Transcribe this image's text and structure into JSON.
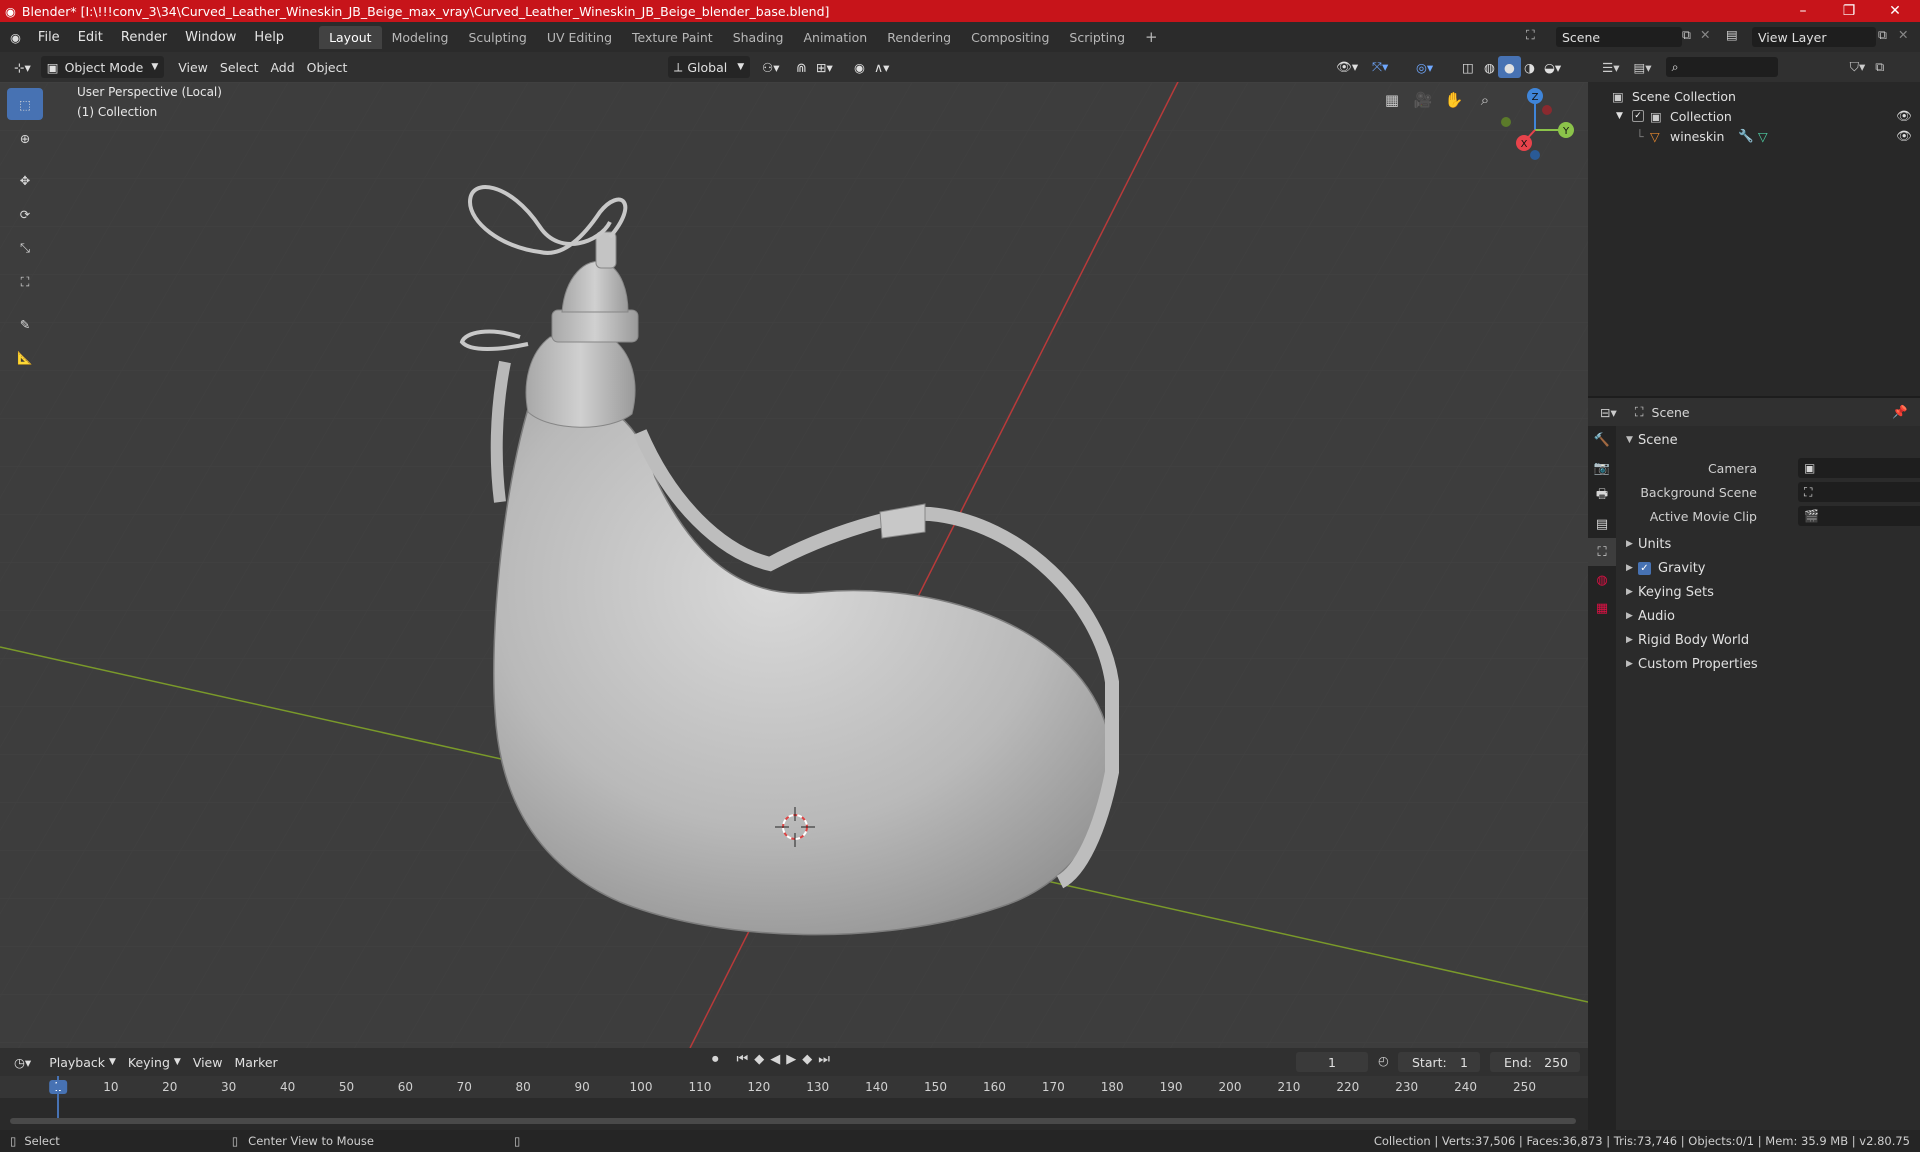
{
  "window": {
    "title": "Blender* [I:\\!!!conv_3\\34\\Curved_Leather_Wineskin_JB_Beige_max_vray\\Curved_Leather_Wineskin_JB_Beige_blender_base.blend]"
  },
  "menu": {
    "file": "File",
    "edit": "Edit",
    "render": "Render",
    "window": "Window",
    "help": "Help"
  },
  "workspaces": [
    "Layout",
    "Modeling",
    "Sculpting",
    "UV Editing",
    "Texture Paint",
    "Shading",
    "Animation",
    "Rendering",
    "Compositing",
    "Scripting"
  ],
  "active_workspace": "Layout",
  "scene_field": "Scene",
  "view_layer_field": "View Layer",
  "viewport_header": {
    "mode": "Object Mode",
    "view": "View",
    "select": "Select",
    "add": "Add",
    "object": "Object",
    "orientation": "Global"
  },
  "viewport": {
    "perspective_label": "User Perspective (Local)",
    "collection_label": "(1) Collection",
    "gizmo": {
      "x": "X",
      "y": "Y",
      "z": "Z"
    }
  },
  "outliner": {
    "scene_collection": "Scene Collection",
    "collection": "Collection",
    "object": "wineskin"
  },
  "properties": {
    "context": "Scene",
    "section": "Scene",
    "camera_label": "Camera",
    "background_scene_label": "Background Scene",
    "active_movie_clip_label": "Active Movie Clip",
    "panels": [
      "Units",
      "Gravity",
      "Keying Sets",
      "Audio",
      "Rigid Body World",
      "Custom Properties"
    ],
    "gravity_checked": true
  },
  "timeline": {
    "playback": "Playback",
    "keying": "Keying",
    "view": "View",
    "marker": "Marker",
    "current_frame": "1",
    "start_label": "Start:",
    "start": "1",
    "end_label": "End:",
    "end": "250",
    "ticks": [
      "1",
      "10",
      "20",
      "30",
      "40",
      "50",
      "60",
      "70",
      "80",
      "90",
      "100",
      "110",
      "120",
      "130",
      "140",
      "150",
      "160",
      "170",
      "180",
      "190",
      "200",
      "210",
      "220",
      "230",
      "240",
      "250"
    ]
  },
  "status": {
    "select": "Select",
    "center_view": "Center View to Mouse",
    "stats": "Collection | Verts:37,506 | Faces:36,873 | Tris:73,746 | Objects:0/1 | Mem: 35.9 MB | v2.80.75"
  },
  "colors": {
    "title_bar": "#c7141a",
    "accent": "#4772b3",
    "axis_x": "#e8434b",
    "axis_y": "#8bc34a",
    "axis_z": "#3f85d9",
    "object_orange": "#e8892e"
  }
}
